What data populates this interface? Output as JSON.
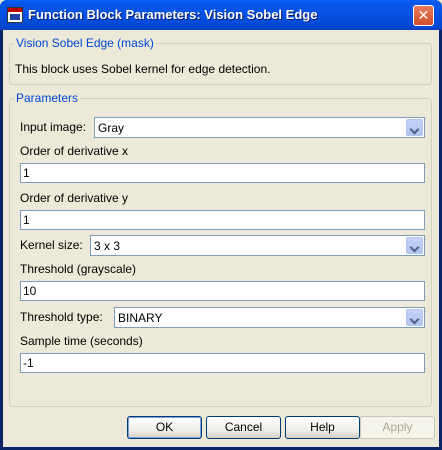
{
  "window": {
    "title": "Function Block Parameters: Vision Sobel Edge",
    "close_glyph": "✕"
  },
  "mask": {
    "group_title": "Vision Sobel Edge (mask)",
    "description": "This block uses Sobel kernel for edge detection."
  },
  "params": {
    "group_title": "Parameters",
    "input_image": {
      "label": "Input image:",
      "value": "Gray"
    },
    "order_x": {
      "label": "Order of derivative x",
      "value": "1"
    },
    "order_y": {
      "label": "Order of derivative y",
      "value": "1"
    },
    "kernel_size": {
      "label": "Kernel size:",
      "value": "3 x 3"
    },
    "threshold": {
      "label": "Threshold (grayscale)",
      "value": "10"
    },
    "threshold_type": {
      "label": "Threshold type:",
      "value": "BINARY"
    },
    "sample_time": {
      "label": "Sample time (seconds)",
      "value": "-1"
    }
  },
  "buttons": {
    "ok": "OK",
    "cancel": "Cancel",
    "help": "Help",
    "apply": "Apply"
  },
  "colors": {
    "titlebar": "#0551e4",
    "group_title": "#0046d5",
    "dialog_bg": "#ece9d8"
  }
}
